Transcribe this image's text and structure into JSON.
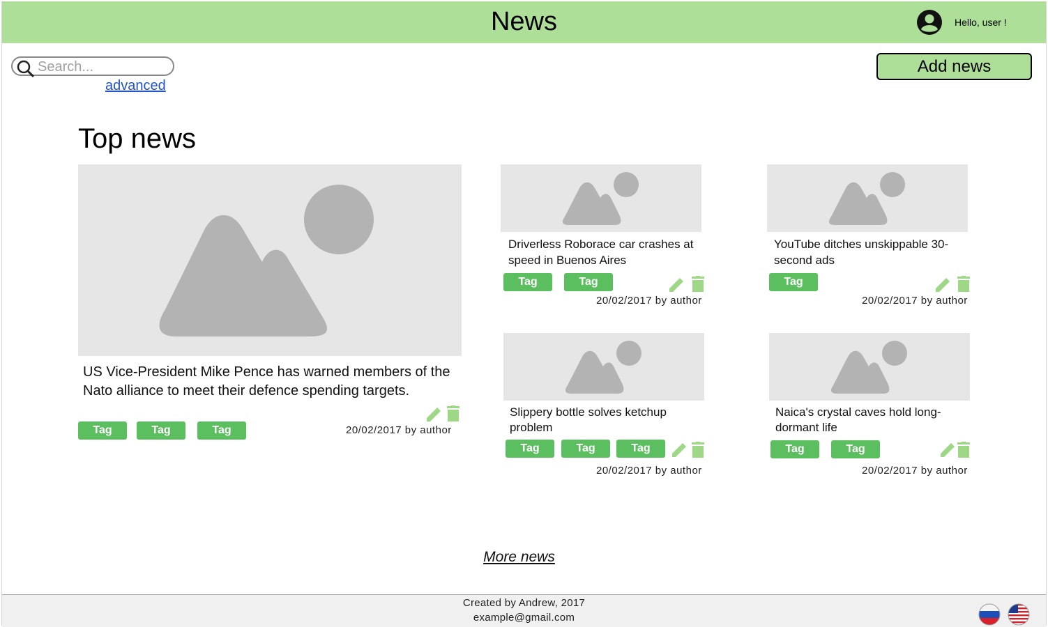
{
  "header": {
    "title": "News",
    "greeting": "Hello, user !",
    "user_icon": "user-circle-icon",
    "bg_color": "#aedf98"
  },
  "search": {
    "placeholder": "Search...",
    "advanced_label": "advanced"
  },
  "add_news_label": "Add news",
  "section_title": "Top news",
  "featured": {
    "headline": " US Vice-President Mike Pence has warned members of the Nato alliance to meet their defence spending targets.",
    "tags": [
      "Tag",
      "Tag",
      "Tag"
    ],
    "meta": "20/02/2017 by author"
  },
  "articles": [
    {
      "headline": " Driverless Roborace car crashes at speed in Buenos Aires",
      "tags": [
        "Tag",
        "Tag"
      ],
      "meta": "20/02/2017 by author"
    },
    {
      "headline": " YouTube ditches unskippable 30-second ads",
      "tags": [
        "Tag"
      ],
      "meta": "20/02/2017 by author"
    },
    {
      "headline": " Slippery bottle solves ketchup problem",
      "tags": [
        "Tag",
        "Tag",
        "Tag"
      ],
      "meta": "20/02/2017 by author"
    },
    {
      "headline": " Naica's crystal caves hold long-dormant life",
      "tags": [
        "Tag",
        "Tag"
      ],
      "meta": "20/02/2017 by author"
    }
  ],
  "more_news_label": "More news",
  "footer": {
    "line1": "Created by Andrew, 2017",
    "line2": "example@gmail.com"
  },
  "languages": [
    "russian-flag-icon",
    "us-flag-icon"
  ],
  "colors": {
    "tag": "#5cbf5f",
    "action_icon": "#9ed887",
    "image_placeholder": "#e6e6e6"
  }
}
